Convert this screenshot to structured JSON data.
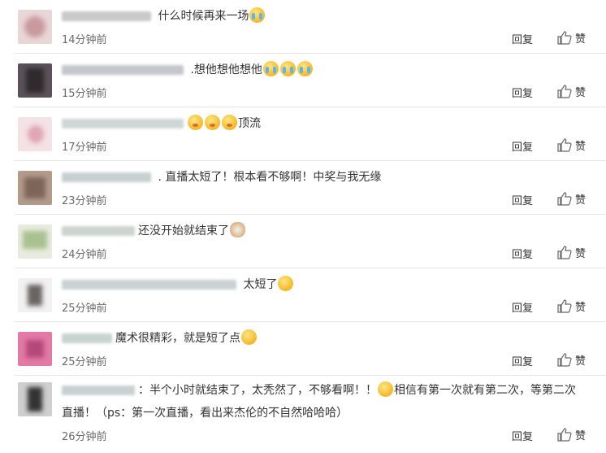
{
  "comments": [
    {
      "text": "什么时候再来一场",
      "time": "14分钟前"
    },
    {
      "text": ".想他想他想他",
      "time": "15分钟前"
    },
    {
      "text": "顶流",
      "time": "17分钟前"
    },
    {
      "text": ". 直播太短了！根本看不够啊！中奖与我无缘",
      "time": "23分钟前"
    },
    {
      "text": "还没开始就结束了",
      "time": "24分钟前"
    },
    {
      "text": "太短了",
      "time": "25分钟前"
    },
    {
      "text": "魔术很精彩，就是短了点",
      "time": "25分钟前"
    },
    {
      "text_a": "：半个小时就结束了，太秃然了，不够看啊！！",
      "text_b": "相信有第一次就有第二次，等第二次直播！（ps：第一次直播，看出来杰伦的不自然哈哈哈）",
      "time": "26分钟前"
    }
  ],
  "actions": {
    "reply": "回复",
    "like": "赞"
  }
}
